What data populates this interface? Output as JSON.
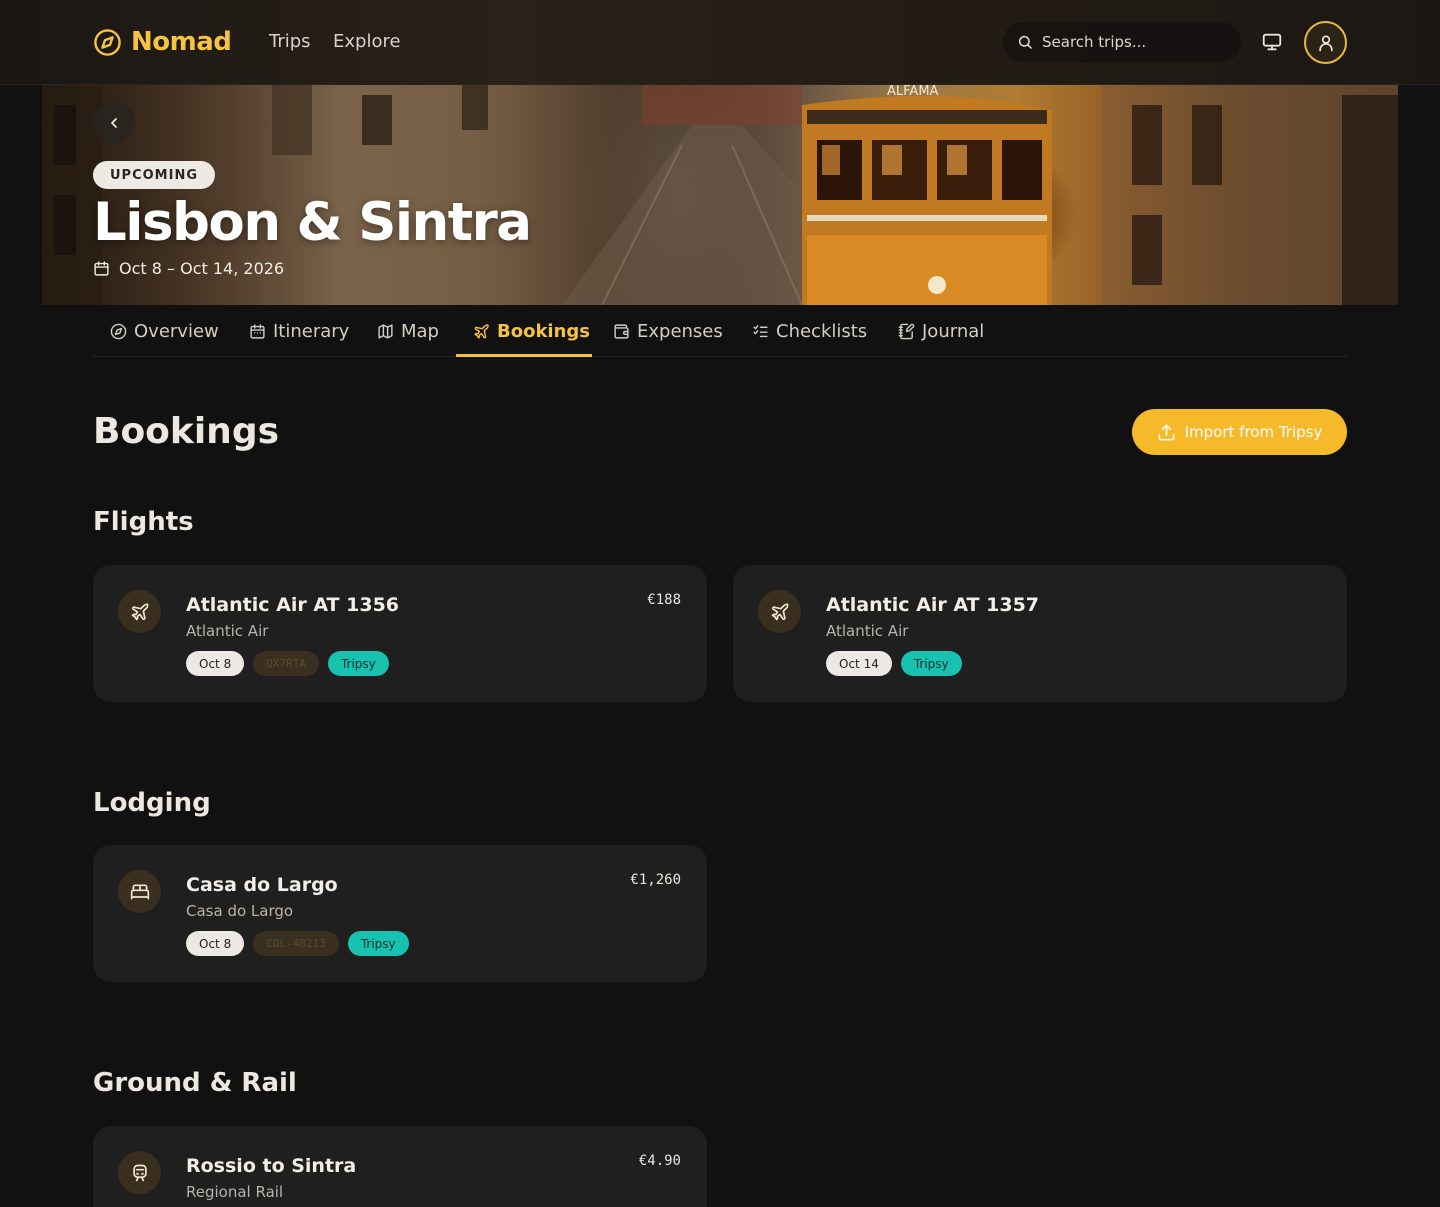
{
  "app": {
    "brand": "Nomad",
    "nav": {
      "trips": "Trips",
      "explore": "Explore"
    },
    "search_placeholder": "Search trips..."
  },
  "colors": {
    "accent": "#F5C242",
    "button": "#F6B92A",
    "tripsy_chip": "#17C2B0",
    "background": "#111111",
    "card": "#1F1F1F"
  },
  "trip": {
    "status": "UPCOMING",
    "title": "Lisbon & Sintra",
    "dates": "Oct 8 – Oct 14, 2026"
  },
  "tabs": [
    {
      "label": "Overview",
      "icon": "compass-icon"
    },
    {
      "label": "Itinerary",
      "icon": "calendar-icon"
    },
    {
      "label": "Map",
      "icon": "map-icon"
    },
    {
      "label": "Bookings",
      "icon": "plane-icon",
      "active": true
    },
    {
      "label": "Expenses",
      "icon": "wallet-icon"
    },
    {
      "label": "Checklists",
      "icon": "checklist-icon"
    },
    {
      "label": "Journal",
      "icon": "journal-icon"
    }
  ],
  "page": {
    "title": "Bookings",
    "import_label": "Import from Tripsy"
  },
  "sections": {
    "flights": {
      "title": "Flights",
      "items": [
        {
          "title": "Atlantic Air AT 1356",
          "subtitle": "Atlantic Air",
          "price": "€188",
          "date": "Oct 8",
          "code": "QX7RTA",
          "source": "Tripsy",
          "icon": "plane-icon"
        },
        {
          "title": "Atlantic Air AT 1357",
          "subtitle": "Atlantic Air",
          "price": "",
          "date": "Oct 14",
          "source": "Tripsy",
          "icon": "plane-icon"
        }
      ]
    },
    "lodging": {
      "title": "Lodging",
      "items": [
        {
          "title": "Casa do Largo",
          "subtitle": "Casa do Largo",
          "price": "€1,260",
          "date": "Oct 8",
          "code": "CDL-48213",
          "source": "Tripsy",
          "icon": "bed-icon"
        }
      ]
    },
    "ground": {
      "title": "Ground & Rail",
      "items": [
        {
          "title": "Rossio to Sintra",
          "subtitle": "Regional Rail",
          "price": "€4.90",
          "icon": "train-icon"
        }
      ]
    }
  }
}
